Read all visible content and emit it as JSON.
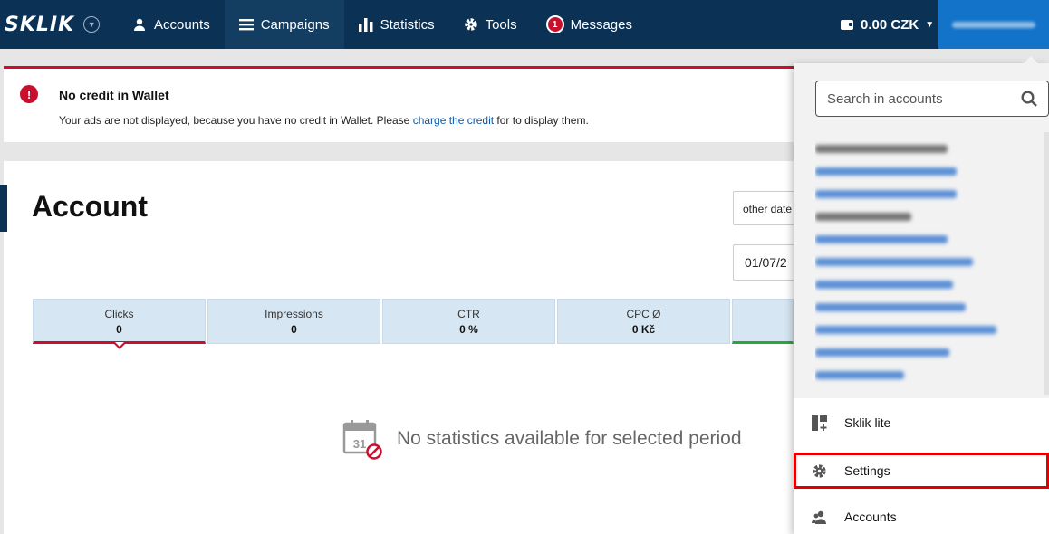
{
  "nav": {
    "logo": "SKLIK",
    "items": [
      {
        "label": "Accounts",
        "icon": "user-icon"
      },
      {
        "label": "Campaigns",
        "icon": "menu-icon"
      },
      {
        "label": "Statistics",
        "icon": "bar-chart-icon"
      },
      {
        "label": "Tools",
        "icon": "gear-icon"
      },
      {
        "label": "Messages",
        "icon": "badge-icon",
        "badge": "1"
      }
    ],
    "active": "Campaigns",
    "wallet": "0.00 CZK"
  },
  "alert": {
    "title": "No credit in Wallet",
    "text_before": "Your ads are not displayed, because you have no credit in Wallet. Please ",
    "link": "charge the credit",
    "text_after": " for to display them."
  },
  "main": {
    "title": "Account",
    "date_select": "other date",
    "date_from": "01/07/2"
  },
  "stats": [
    {
      "label": "Clicks",
      "value": "0"
    },
    {
      "label": "Impressions",
      "value": "0"
    },
    {
      "label": "CTR",
      "value": "0 %"
    },
    {
      "label": "CPC Ø",
      "value": "0 Kč"
    }
  ],
  "empty_state": {
    "icon_day": "31",
    "text": "No statistics available for selected period"
  },
  "dropdown": {
    "search_placeholder": "Search in accounts",
    "items": [
      {
        "label": "Sklik lite",
        "icon": "dashboard-icon"
      },
      {
        "label": "Settings",
        "icon": "gear-icon"
      },
      {
        "label": "Accounts",
        "icon": "users-icon"
      }
    ]
  },
  "colors": {
    "nav_bg": "#0b3255",
    "alert_red": "#c8102e",
    "link_blue": "#0b57a6",
    "highlight": "#e00000"
  }
}
